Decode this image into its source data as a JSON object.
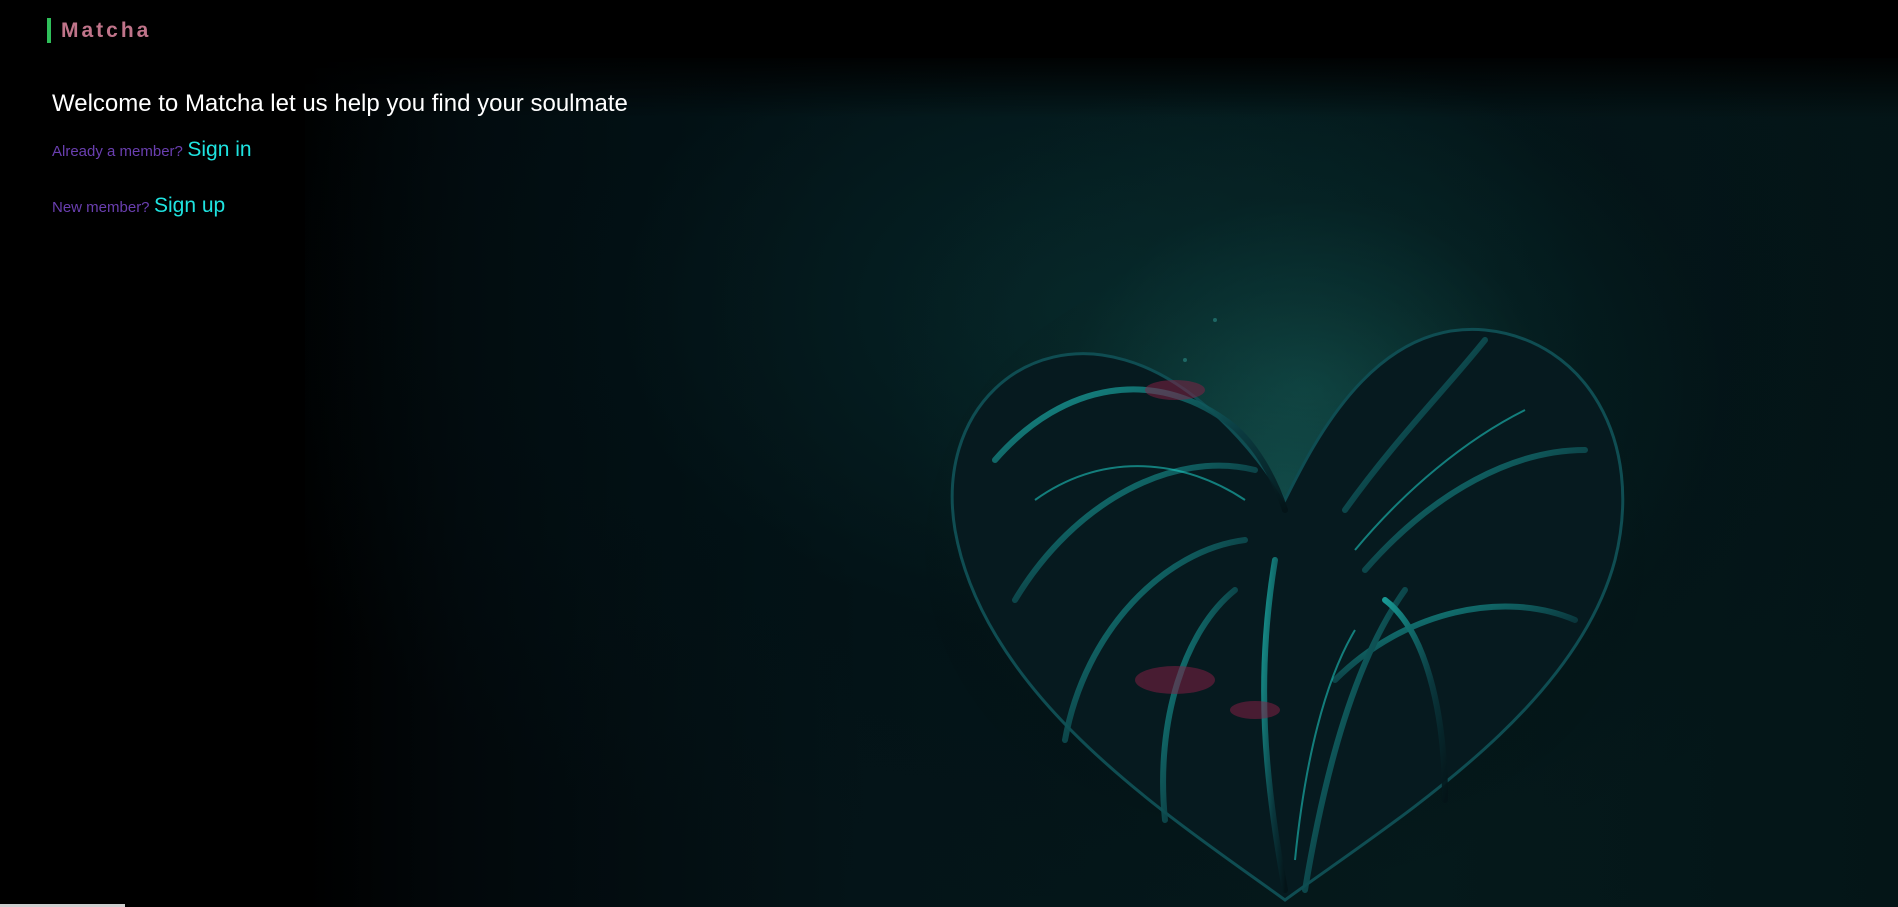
{
  "header": {
    "brand": "Matcha"
  },
  "main": {
    "welcome": "Welcome to Matcha let us help you find your soulmate",
    "signin_prompt": "Already a member?",
    "signin_link": "Sign in",
    "signup_prompt": "New member?",
    "signup_link": "Sign up"
  },
  "colors": {
    "brand_text": "#c0748a",
    "brand_bar": "#2fbf5a",
    "prompt_text": "#6a3fb0",
    "link_text": "#1fe3e0",
    "background": "#000000"
  },
  "background_image": "dark-teal-heart-artwork"
}
